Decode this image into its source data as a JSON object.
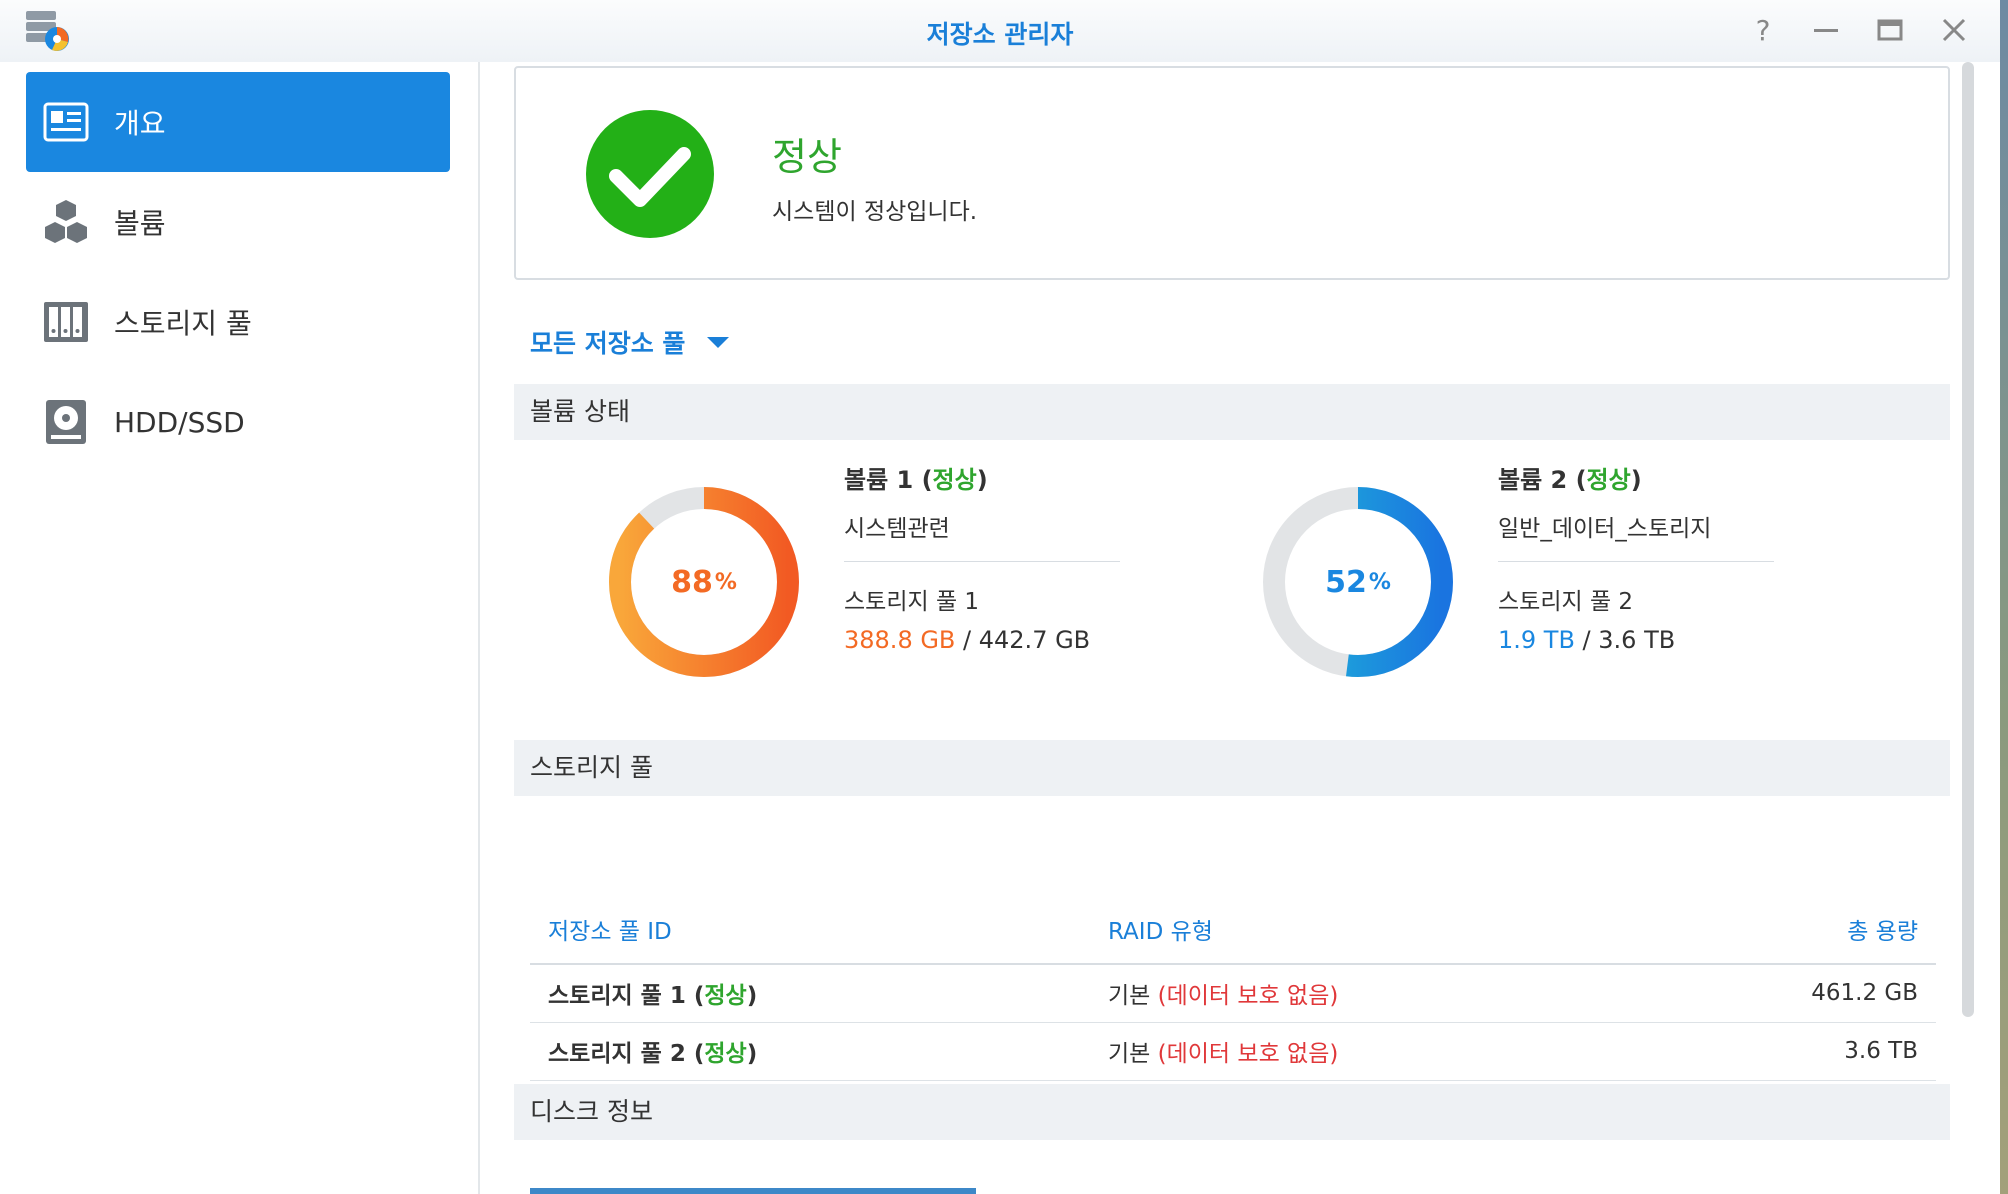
{
  "window": {
    "title": "저장소 관리자"
  },
  "sidebar": {
    "items": [
      {
        "label": "개요",
        "icon": "overview-icon",
        "active": true
      },
      {
        "label": "볼륨",
        "icon": "cubes-icon",
        "active": false
      },
      {
        "label": "스토리지 풀",
        "icon": "storage-pool-icon",
        "active": false
      },
      {
        "label": "HDD/SSD",
        "icon": "disk-icon",
        "active": false
      }
    ]
  },
  "status": {
    "title": "정상",
    "description": "시스템이 정상입니다.",
    "color": "#2fa52e"
  },
  "filter": {
    "label": "모든 저장소 풀"
  },
  "sections": {
    "volume_status": "볼륨 상태",
    "storage_pool": "스토리지 풀",
    "disk_info": "디스크 정보"
  },
  "volumes": [
    {
      "name": "볼륨 1",
      "status": "정상",
      "description": "시스템관련",
      "pool": "스토리지 풀 1",
      "percent": 88,
      "percent_label": "88",
      "used": "388.8 GB",
      "total": "442.7 GB",
      "color": "#f36a24"
    },
    {
      "name": "볼륨 2",
      "status": "정상",
      "description": "일반_데이터_스토리지",
      "pool": "스토리지 풀 2",
      "percent": 52,
      "percent_label": "52",
      "used": "1.9 TB",
      "total": "3.6 TB",
      "color": "#1a87e0"
    }
  ],
  "pool_table": {
    "columns": {
      "id": "저장소 풀 ID",
      "raid": "RAID 유형",
      "capacity": "총 용량"
    },
    "rows": [
      {
        "name": "스토리지 풀 1",
        "status": "정상",
        "raid": "기본",
        "raid_note": "(데이터 보호 없음)",
        "capacity": "461.2 GB"
      },
      {
        "name": "스토리지 풀 2",
        "status": "정상",
        "raid": "기본",
        "raid_note": "(데이터 보호 없음)",
        "capacity": "3.6 TB"
      }
    ]
  },
  "ui": {
    "paren_open": "(",
    "paren_close": ")",
    "slash": " / ",
    "pct": "%"
  }
}
